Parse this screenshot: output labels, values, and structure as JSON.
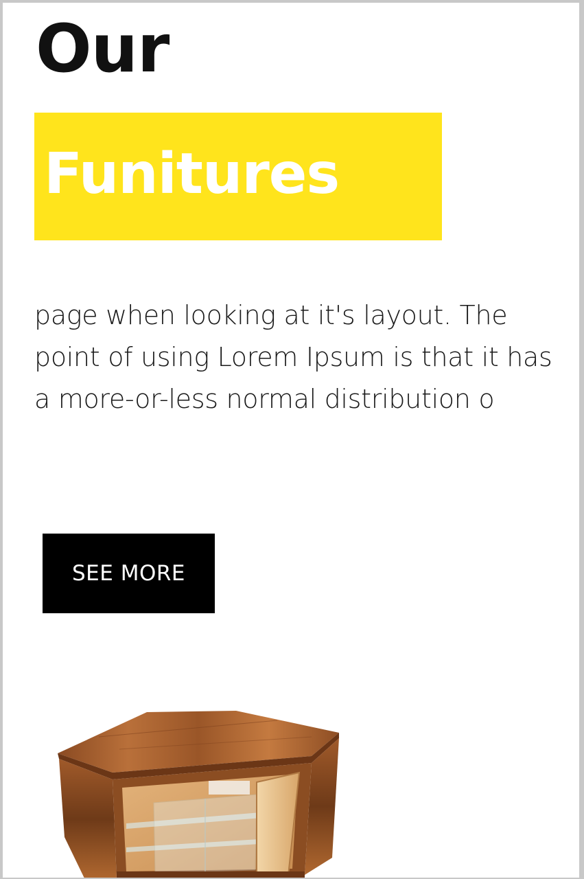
{
  "hero": {
    "title_line1": "Our",
    "title_line2": "Funitures",
    "description": "page when looking at it's layout. The point of using Lorem Ipsum is that it has a more-or-less normal distribution o",
    "button_label": "SEE MORE"
  },
  "colors": {
    "accent": "#ffe41c",
    "button_bg": "#000000",
    "button_text": "#ffffff",
    "title": "#111111"
  },
  "product": {
    "image_subject": "wooden corner cabinet"
  }
}
